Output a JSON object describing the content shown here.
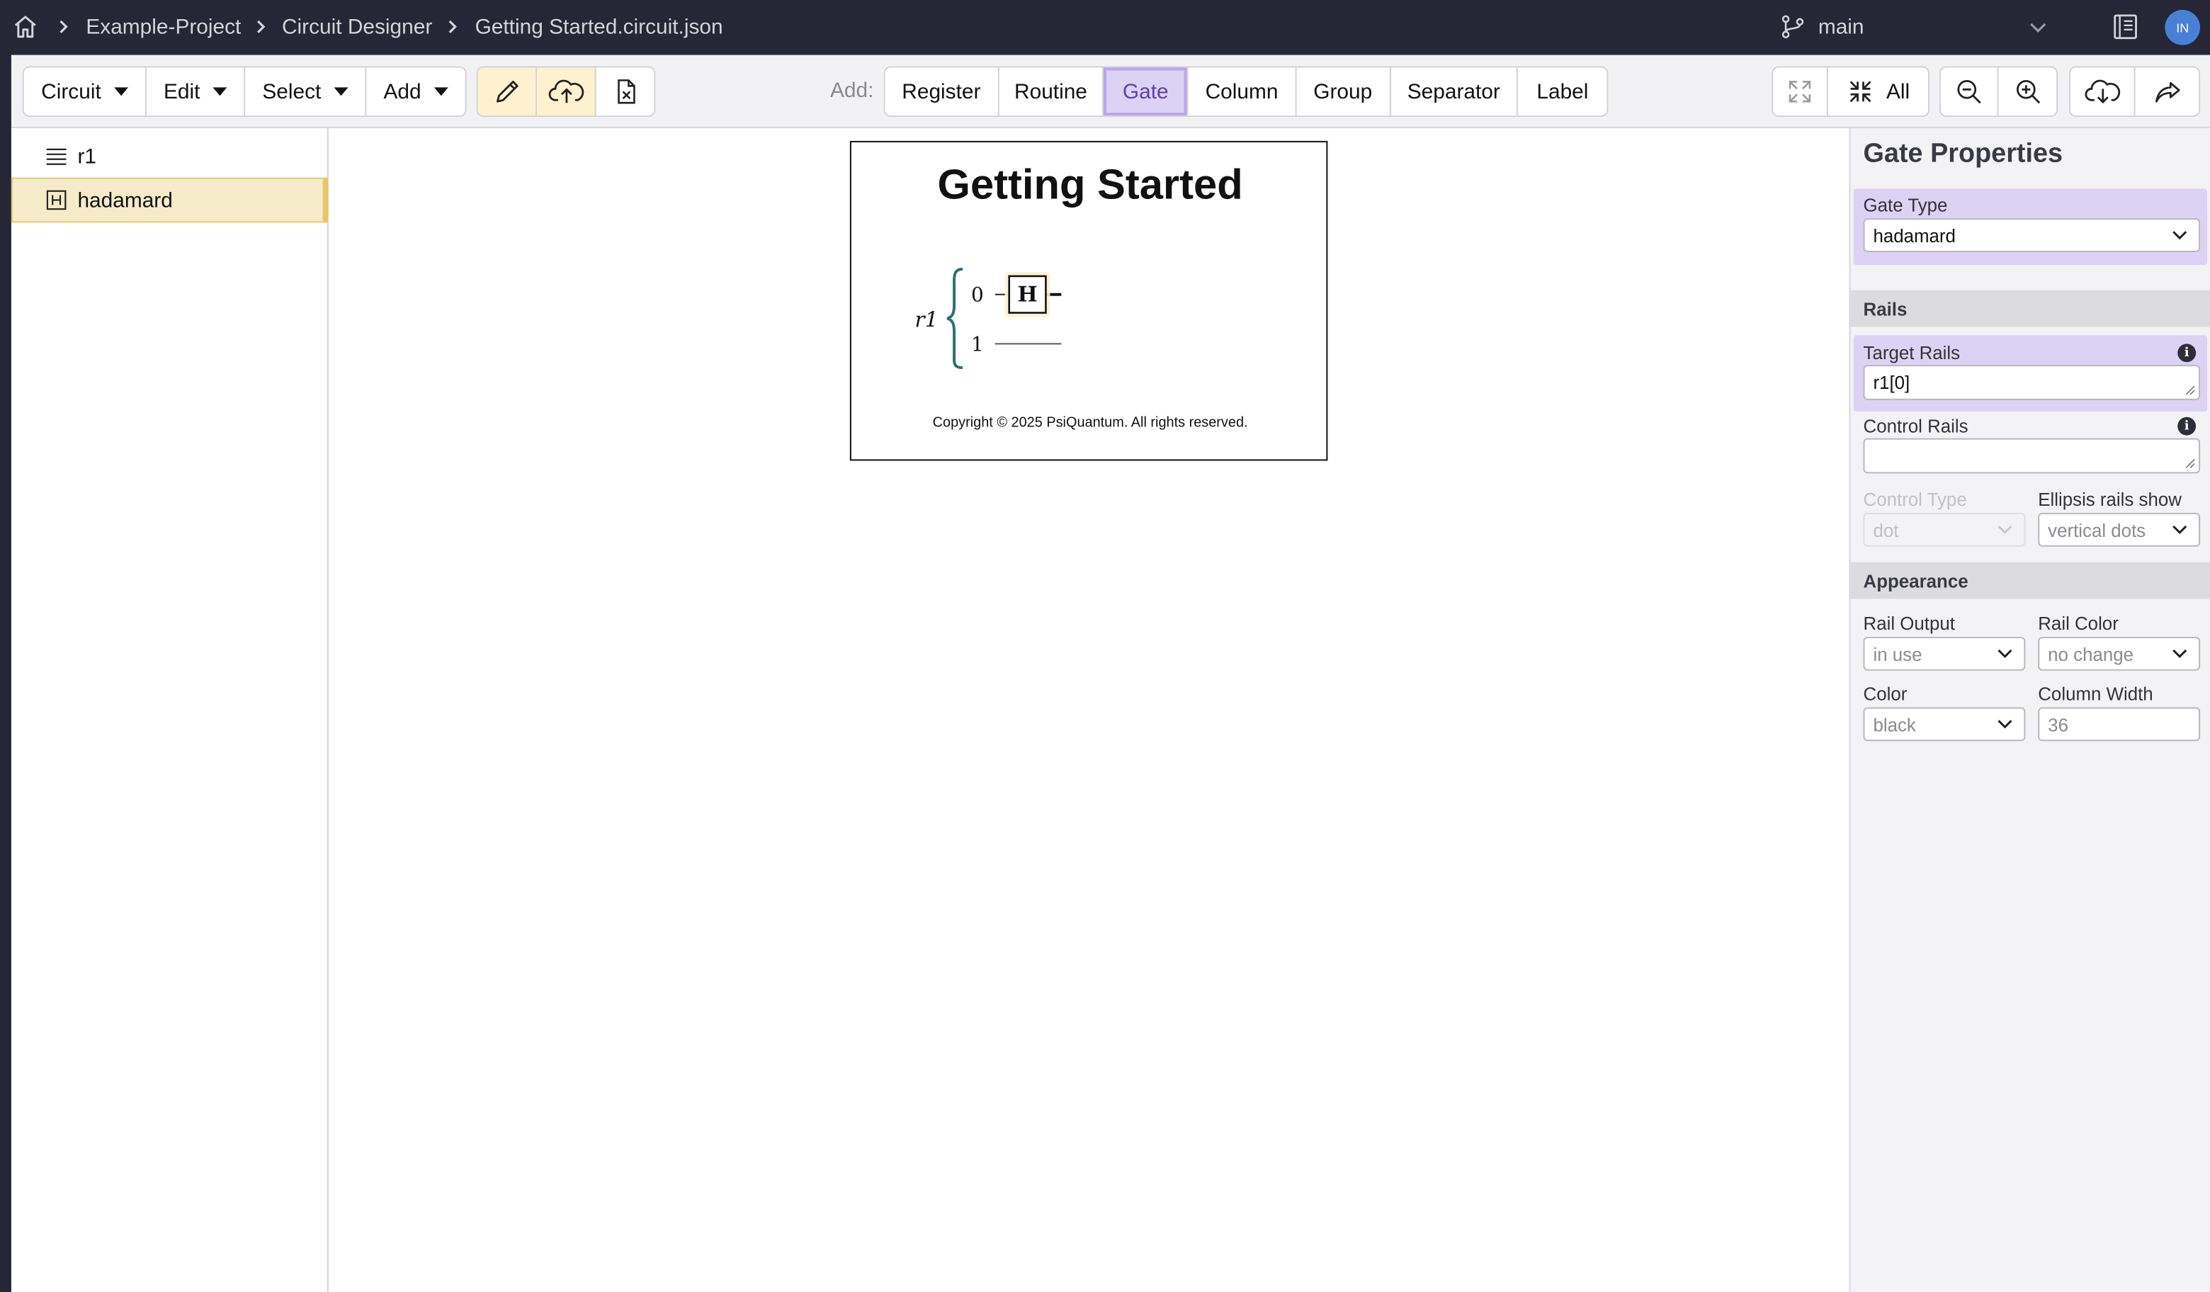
{
  "breadcrumb": [
    "Example-Project",
    "Circuit Designer",
    "Getting Started.circuit.json"
  ],
  "branch": "main",
  "avatar_initials": "IN",
  "toolbar": {
    "menus": [
      "Circuit",
      "Edit",
      "Select",
      "Add"
    ],
    "add_label": "Add:",
    "add_items": [
      "Register",
      "Routine",
      "Gate",
      "Column",
      "Group",
      "Separator",
      "Label"
    ],
    "active_add_item": "Gate",
    "expand_all_label": "All"
  },
  "tree": {
    "items": [
      {
        "label": "r1",
        "icon": "register-lines-icon",
        "selected": false
      },
      {
        "label": "hadamard",
        "icon": "gate-h-icon",
        "selected": true
      }
    ]
  },
  "canvas": {
    "title": "Getting Started",
    "register_label": "r1",
    "rail_indices": [
      "0",
      "1"
    ],
    "gate_symbol": "H",
    "copyright": "Copyright © 2025 PsiQuantum. All rights reserved."
  },
  "properties": {
    "title": "Gate Properties",
    "gate_type_label": "Gate Type",
    "gate_type_value": "hadamard",
    "rails_section": "Rails",
    "target_rails_label": "Target Rails",
    "target_rails_value": "r1[0]",
    "control_rails_label": "Control Rails",
    "control_rails_value": "",
    "control_type_label": "Control Type",
    "control_type_value": "dot",
    "ellipsis_label": "Ellipsis rails show",
    "ellipsis_value": "vertical dots",
    "appearance_section": "Appearance",
    "rail_output_label": "Rail Output",
    "rail_output_value": "in use",
    "rail_color_label": "Rail Color",
    "rail_color_value": "no change",
    "color_label": "Color",
    "color_value": "black",
    "column_width_label": "Column Width",
    "column_width_value": "36"
  },
  "colors": {
    "topbar": "#262637",
    "accent_purple": "#dcd2f4",
    "tool_active": "#fdf1cf",
    "brace_teal": "#2f6f73"
  }
}
